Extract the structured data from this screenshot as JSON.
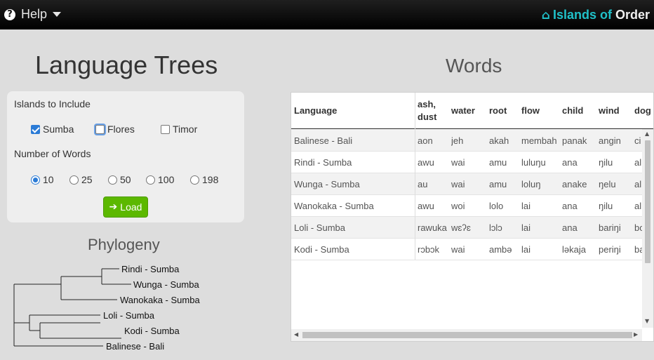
{
  "navbar": {
    "help_label": "Help",
    "help_icon": "?",
    "brand_part1": "Islands of",
    "brand_part2": "Order",
    "brand_color": "#20c0c8"
  },
  "left": {
    "title": "Language Trees",
    "islands_label": "Islands to Include",
    "islands": [
      {
        "label": "Sumba",
        "checked": true
      },
      {
        "label": "Flores",
        "checked": false
      },
      {
        "label": "Timor",
        "checked": false
      }
    ],
    "words_label": "Number of Words",
    "word_counts": [
      {
        "label": "10",
        "selected": true
      },
      {
        "label": "25",
        "selected": false
      },
      {
        "label": "50",
        "selected": false
      },
      {
        "label": "100",
        "selected": false
      },
      {
        "label": "198",
        "selected": false
      }
    ],
    "load_label": "Load",
    "load_color": "#5cb800",
    "phylogeny_title": "Phylogeny",
    "tree_leaves": [
      "Rindi - Sumba",
      "Wunga - Sumba",
      "Wanokaka - Sumba",
      "Loli - Sumba",
      "Kodi - Sumba",
      "Balinese - Bali"
    ]
  },
  "words": {
    "title": "Words",
    "columns": [
      "Language",
      "ash, dust",
      "water",
      "root",
      "flow",
      "child",
      "wind",
      "dog"
    ],
    "rows": [
      [
        "Balinese - Bali",
        "aon",
        "jeh",
        "akah",
        "membah",
        "panak",
        "angin",
        "ci"
      ],
      [
        "Rindi - Sumba",
        "awu",
        "wai",
        "amu",
        "luluŋu",
        "ana",
        "ŋilu",
        "al"
      ],
      [
        "Wunga - Sumba",
        "au",
        "wai",
        "amu",
        "loluŋ",
        "anake",
        "ŋelu",
        "al"
      ],
      [
        "Wanokaka - Sumba",
        "awu",
        "woi",
        "lolo",
        "lai",
        "ana",
        "ŋilu",
        "al"
      ],
      [
        "Loli - Sumba",
        "rawuka",
        "wɛʔɛ",
        "lɔlɔ",
        "lai",
        "ana",
        "bariŋi",
        "bo"
      ],
      [
        "Kodi - Sumba",
        "rɔbɔk",
        "wai",
        "ambə",
        "lai",
        "ləkaja",
        "periŋi",
        "ba"
      ]
    ]
  }
}
